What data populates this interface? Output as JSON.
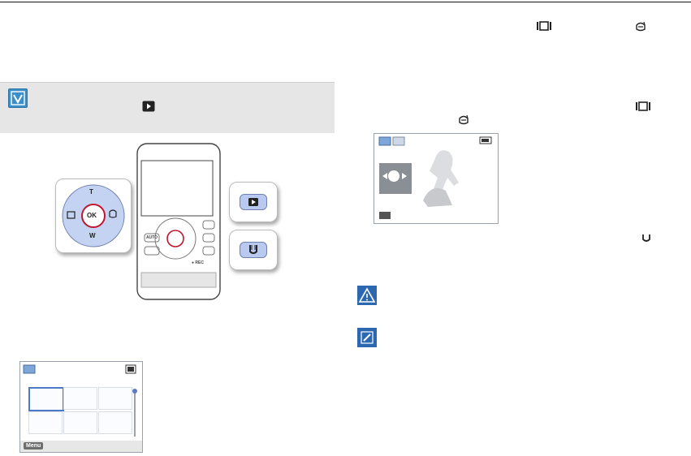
{
  "device": {
    "dpad": {
      "top": "T",
      "center": "OK",
      "bottom": "W"
    },
    "small_buttons": {
      "auto": "AUTO",
      "rec": "● REC"
    }
  },
  "thumbnail_screen": {
    "menu_label": "Menu"
  },
  "icons": {
    "tip": "check-note-icon",
    "play": "play-icon",
    "single_view": "single-view-icon",
    "smart_mode": "diver-mask-icon",
    "battery": "battery-icon",
    "warning": "warning-icon",
    "note": "pencil-note-icon",
    "usb": "u-button-icon"
  },
  "colors": {
    "tip_background": "#e6e6e6",
    "accent_blue": "#3b8fc9",
    "button_blue": "#b9c9ef",
    "ok_ring": "#c0152f"
  }
}
